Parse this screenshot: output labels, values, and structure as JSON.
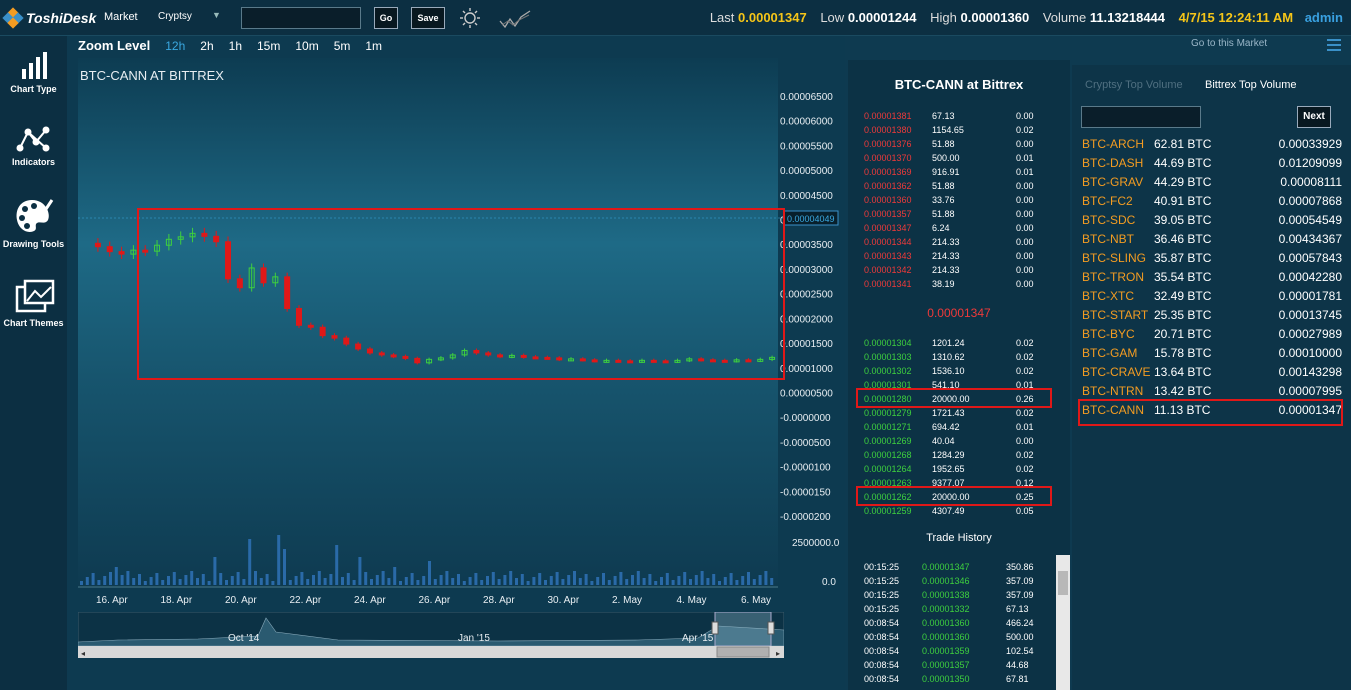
{
  "app": {
    "logo_text": "ToshiDesk"
  },
  "toolbar": {
    "market_label": "Market",
    "exchange": "Cryptsy",
    "search_value": "",
    "go_label": "Go",
    "save_label": "Save"
  },
  "ticker": {
    "last_label": "Last",
    "last": "0.00001347",
    "low_label": "Low",
    "low": "0.00001244",
    "high_label": "High",
    "high": "0.00001360",
    "volume_label": "Volume",
    "volume": "11.13218444",
    "datetime": "4/7/15 12:24:11 AM",
    "user": "admin"
  },
  "sidebar": {
    "items": [
      {
        "label": "Chart Type",
        "icon": "bar-chart-icon"
      },
      {
        "label": "Indicators",
        "icon": "network-icon"
      },
      {
        "label": "Drawing Tools",
        "icon": "palette-icon"
      },
      {
        "label": "Chart Themes",
        "icon": "themes-icon"
      }
    ]
  },
  "zoom": {
    "label": "Zoom Level",
    "options": [
      "12h",
      "2h",
      "1h",
      "15m",
      "10m",
      "5m",
      "1m"
    ],
    "active": "12h"
  },
  "chart": {
    "title": "BTC-CANN AT BITTREX",
    "current_price_tag": "0.00004049",
    "price_axis": [
      "0.00006500",
      "0.00006000",
      "0.00005500",
      "0.00005000",
      "0.00004500",
      "0.00004000",
      "0.00003500",
      "0.00003000",
      "0.00002500",
      "0.00002000",
      "0.00001500",
      "0.00001000",
      "0.00000500",
      "-0.0000000",
      "-0.0000500",
      "-0.0000100",
      "-0.0000150",
      "-0.0000200"
    ],
    "volume_axis": [
      "2500000.0",
      "0.0"
    ],
    "x_axis": [
      "16. Apr",
      "18. Apr",
      "20. Apr",
      "22. Apr",
      "24. Apr",
      "26. Apr",
      "28. Apr",
      "30. Apr",
      "2. May",
      "4. May",
      "6. May"
    ],
    "navigator_labels": [
      "Oct '14",
      "Jan '15",
      "Apr '15"
    ],
    "colors": {
      "up": "#3ed03e",
      "down": "#e01818",
      "volume": "#2a6aa8"
    }
  },
  "chart_data": {
    "type": "candlestick",
    "title": "BTC-CANN AT BITTREX",
    "y_range": [
      -2e-05,
      6.5e-05
    ],
    "candles_close": [
      3.45e-05,
      3.35e-05,
      3.3e-05,
      3.38e-05,
      3.36e-05,
      3.48e-05,
      3.6e-05,
      3.65e-05,
      3.72e-05,
      3.66e-05,
      3.55e-05,
      2.8e-05,
      2.62e-05,
      3.02e-05,
      2.72e-05,
      2.84e-05,
      2.2e-05,
      1.86e-05,
      1.82e-05,
      1.65e-05,
      1.6e-05,
      1.48e-05,
      1.38e-05,
      1.3e-05,
      1.26e-05,
      1.23e-05,
      1.19e-05,
      1.1e-05,
      1.17e-05,
      1.2e-05,
      1.26e-05,
      1.35e-05,
      1.3e-05,
      1.26e-05,
      1.23e-05,
      1.25e-05,
      1.22e-05,
      1.21e-05,
      1.2e-05,
      1.17e-05,
      1.18e-05,
      1.16e-05,
      1.14e-05,
      1.15e-05,
      1.14e-05,
      1.13e-05,
      1.15e-05,
      1.14e-05,
      1.13e-05,
      1.15e-05,
      1.18e-05,
      1.16e-05,
      1.15e-05,
      1.14e-05,
      1.16e-05,
      1.15e-05,
      1.17e-05,
      1.21e-05
    ]
  },
  "gotomarket": "Go to this Market",
  "orderbook": {
    "title": "BTC-CANN at Bittrex",
    "asks": [
      [
        "0.00001381",
        "67.13",
        "0.00"
      ],
      [
        "0.00001380",
        "1154.65",
        "0.02"
      ],
      [
        "0.00001376",
        "51.88",
        "0.00"
      ],
      [
        "0.00001370",
        "500.00",
        "0.01"
      ],
      [
        "0.00001369",
        "916.91",
        "0.01"
      ],
      [
        "0.00001362",
        "51.88",
        "0.00"
      ],
      [
        "0.00001360",
        "33.76",
        "0.00"
      ],
      [
        "0.00001357",
        "51.88",
        "0.00"
      ],
      [
        "0.00001347",
        "6.24",
        "0.00"
      ],
      [
        "0.00001344",
        "214.33",
        "0.00"
      ],
      [
        "0.00001343",
        "214.33",
        "0.00"
      ],
      [
        "0.00001342",
        "214.33",
        "0.00"
      ],
      [
        "0.00001341",
        "38.19",
        "0.00"
      ]
    ],
    "last_price": "0.00001347",
    "bids": [
      [
        "0.00001304",
        "1201.24",
        "0.02"
      ],
      [
        "0.00001303",
        "1310.62",
        "0.02"
      ],
      [
        "0.00001302",
        "1536.10",
        "0.02"
      ],
      [
        "0.00001301",
        "541.10",
        "0.01"
      ],
      [
        "0.00001280",
        "20000.00",
        "0.26"
      ],
      [
        "0.00001279",
        "1721.43",
        "0.02"
      ],
      [
        "0.00001271",
        "694.42",
        "0.01"
      ],
      [
        "0.00001269",
        "40.04",
        "0.00"
      ],
      [
        "0.00001268",
        "1284.29",
        "0.02"
      ],
      [
        "0.00001264",
        "1952.65",
        "0.02"
      ],
      [
        "0.00001263",
        "9377.07",
        "0.12"
      ],
      [
        "0.00001262",
        "20000.00",
        "0.25"
      ],
      [
        "0.00001259",
        "4307.49",
        "0.05"
      ]
    ]
  },
  "trade_history": {
    "title": "Trade History",
    "rows": [
      [
        "00:15:25",
        "0.00001347",
        "350.86"
      ],
      [
        "00:15:25",
        "0.00001346",
        "357.09"
      ],
      [
        "00:15:25",
        "0.00001338",
        "357.09"
      ],
      [
        "00:15:25",
        "0.00001332",
        "67.13"
      ],
      [
        "00:08:54",
        "0.00001360",
        "466.24"
      ],
      [
        "00:08:54",
        "0.00001360",
        "500.00"
      ],
      [
        "00:08:54",
        "0.00001359",
        "102.54"
      ],
      [
        "00:08:54",
        "0.00001357",
        "44.68"
      ],
      [
        "00:08:54",
        "0.00001350",
        "67.81"
      ]
    ]
  },
  "markets": {
    "tab_cryptsy": "Cryptsy Top Volume",
    "tab_bittrex": "Bittrex Top Volume",
    "next_label": "Next",
    "rows": [
      [
        "BTC-ARCH",
        "62.81 BTC",
        "0.00033929"
      ],
      [
        "BTC-DASH",
        "44.69 BTC",
        "0.01209099"
      ],
      [
        "BTC-GRAV",
        "44.29 BTC",
        "0.00008111"
      ],
      [
        "BTC-FC2",
        "40.91 BTC",
        "0.00007868"
      ],
      [
        "BTC-SDC",
        "39.05 BTC",
        "0.00054549"
      ],
      [
        "BTC-NBT",
        "36.46 BTC",
        "0.00434367"
      ],
      [
        "BTC-SLING",
        "35.87 BTC",
        "0.00057843"
      ],
      [
        "BTC-TRON",
        "35.54 BTC",
        "0.00042280"
      ],
      [
        "BTC-XTC",
        "32.49 BTC",
        "0.00001781"
      ],
      [
        "BTC-START",
        "25.35 BTC",
        "0.00013745"
      ],
      [
        "BTC-BYC",
        "20.71 BTC",
        "0.00027989"
      ],
      [
        "BTC-GAM",
        "15.78 BTC",
        "0.00010000"
      ],
      [
        "BTC-CRAVE",
        "13.64 BTC",
        "0.00143298"
      ],
      [
        "BTC-NTRN",
        "13.42 BTC",
        "0.00007995"
      ],
      [
        "BTC-CANN",
        "11.13 BTC",
        "0.00001347"
      ]
    ]
  }
}
